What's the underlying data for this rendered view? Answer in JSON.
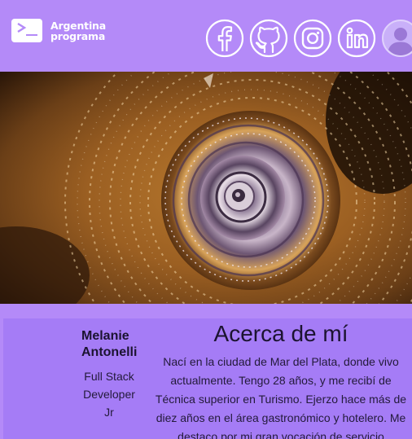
{
  "header": {
    "logo_line1": "Argentina",
    "logo_line2": "programa",
    "social": [
      {
        "icon": "facebook-icon"
      },
      {
        "icon": "github-icon"
      },
      {
        "icon": "instagram-icon"
      },
      {
        "icon": "linkedin-icon"
      },
      {
        "icon": "user-icon"
      }
    ]
  },
  "banner": {
    "subject": "snail-shell-spiral-photo"
  },
  "profile": {
    "first_name": "Melanie",
    "last_name": "Antonelli",
    "role_line1": "Full Stack",
    "role_line2": "Developer",
    "role_line3": "Jr"
  },
  "about": {
    "title": "Acerca de mí",
    "text": "Nací en la ciudad de Mar del Plata, donde vivo actualmente. Tengo 28 años, y me recibí de Técnica superior en Turismo. Ejerzo hace más de diez años en el área gastronómico y hotelero. Me destaco por mi gran vocación de servicio"
  },
  "colors": {
    "background": "#b48af8",
    "card": "#a57cf6",
    "text_dark": "#1b1330"
  }
}
